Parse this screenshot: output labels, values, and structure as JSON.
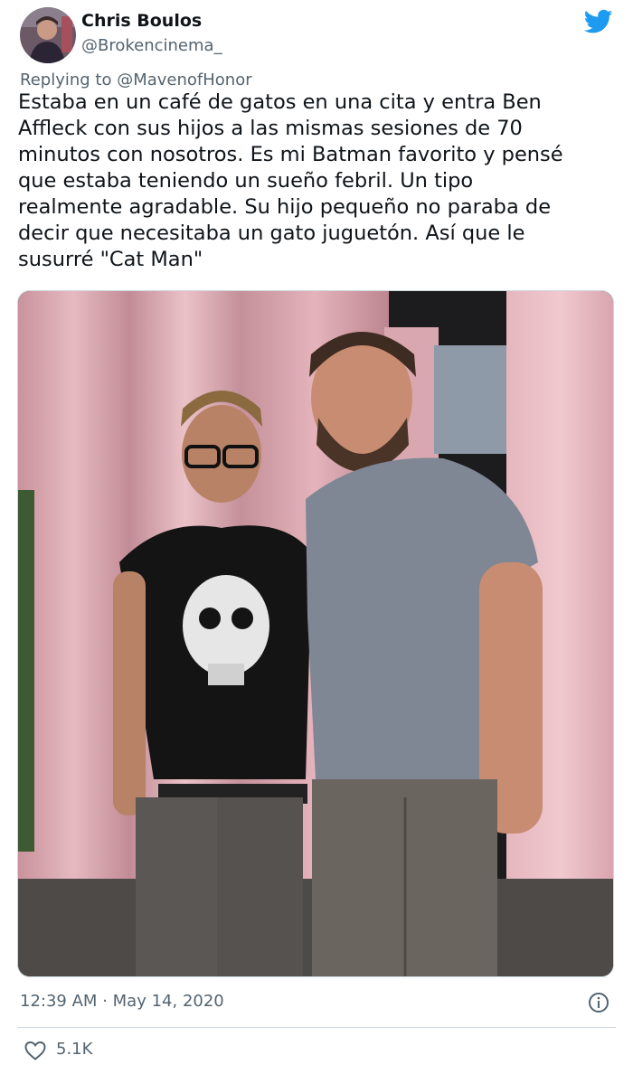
{
  "tweet": {
    "author_name": "Chris Boulos",
    "author_handle": "@Brokencinema_",
    "reply_prefix": "Replying to",
    "reply_handle": "@MavenofHonor",
    "body_lines": [
      "Estaba en un café de gatos en una cita y entra Ben",
      "Affleck con sus hijos a las mismas sesiones de 70",
      "minutos con nosotros. Es mi Batman favorito y pensé",
      "que estaba teniendo un sueño febril. Un tipo",
      "realmente agradable. Su hijo pequeño no paraba de",
      "decir que necesitaba un gato juguetón. Así que le",
      "susurré \"Cat Man\""
    ],
    "time": "12:39 AM",
    "separator": "·",
    "date": "May 14, 2020",
    "likes": "5.1K"
  },
  "icons": {
    "brand": "twitter-bird-icon",
    "info": "info-icon",
    "like": "heart-icon"
  },
  "colors": {
    "twitter_blue": "#1d9bf0",
    "secondary_text": "#536471",
    "divider": "#cfd9de"
  }
}
